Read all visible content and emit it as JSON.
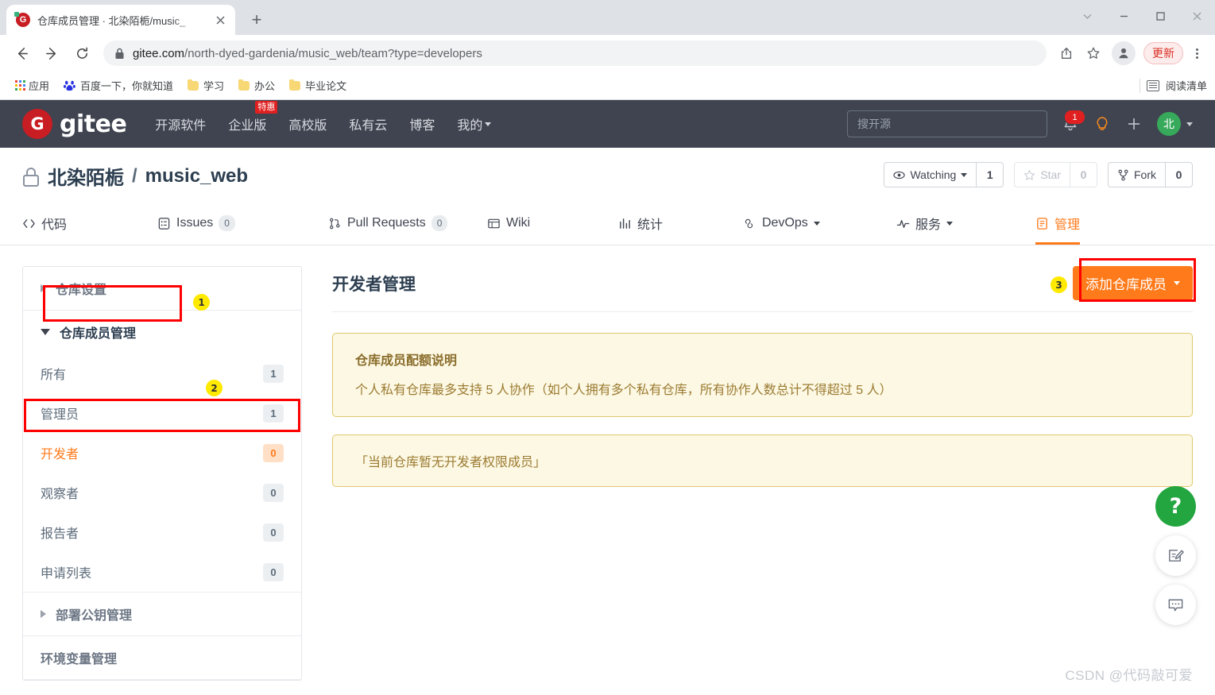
{
  "browser": {
    "tab": {
      "title": "仓库成员管理 · 北染陌栀/music_",
      "favicon": "gitee-favicon",
      "close_icon": "close-icon"
    },
    "new_tab_icon": "plus-icon",
    "window_controls": [
      "chevron-down-icon",
      "minimize-icon",
      "maximize-icon",
      "close-icon"
    ],
    "nav": {
      "back_icon": "back-arrow-icon",
      "forward_icon": "forward-arrow-icon",
      "reload_icon": "reload-icon"
    },
    "omnibox": {
      "lock_icon": "lock-icon",
      "url_host": "gitee.com",
      "url_path": "/north-dyed-gardenia/music_web/team?type=developers"
    },
    "toolbar_icons": [
      "share-icon",
      "bookmark-star-icon",
      "profile-icon"
    ],
    "update_label": "更新",
    "menu_icon": "three-dots-icon",
    "bookmarks": [
      {
        "label": "应用",
        "icon": "apps-grid-icon"
      },
      {
        "label": "百度一下，你就知道",
        "icon": "baidu-icon"
      },
      {
        "label": "学习",
        "icon": "folder-icon"
      },
      {
        "label": "办公",
        "icon": "folder-icon"
      },
      {
        "label": "毕业论文",
        "icon": "folder-icon"
      }
    ],
    "reading_list": {
      "label": "阅读清单",
      "icon": "reading-list-icon"
    }
  },
  "gitee_header": {
    "logo_letter": "G",
    "logo_text": "gitee",
    "nav": [
      {
        "label": "开源软件",
        "badge": null,
        "caret": false
      },
      {
        "label": "企业版",
        "badge": "特惠",
        "caret": false
      },
      {
        "label": "高校版",
        "badge": null,
        "caret": false
      },
      {
        "label": "私有云",
        "badge": null,
        "caret": false
      },
      {
        "label": "博客",
        "badge": null,
        "caret": false
      },
      {
        "label": "我的",
        "badge": null,
        "caret": true
      }
    ],
    "search_placeholder": "搜开源",
    "notification_count": "1",
    "icons": [
      "bell-icon",
      "lightbulb-icon",
      "plus-icon"
    ],
    "avatar_letter": "北"
  },
  "repo": {
    "lock_icon": "lock-icon",
    "owner": "北染陌栀",
    "separator": "/",
    "name": "music_web",
    "actions": [
      {
        "name": "watching",
        "icon": "eye-icon",
        "label": "Watching",
        "caret": true,
        "count": "1",
        "disabled": false
      },
      {
        "name": "star",
        "icon": "star-icon",
        "label": "Star",
        "caret": false,
        "count": "0",
        "disabled": true
      },
      {
        "name": "fork",
        "icon": "fork-icon",
        "label": "Fork",
        "caret": false,
        "count": "0",
        "disabled": false
      }
    ],
    "tabs": [
      {
        "name": "code",
        "icon": "code-icon",
        "label": "代码",
        "badge": null,
        "caret": false,
        "active": false
      },
      {
        "name": "issues",
        "icon": "issues-icon",
        "label": "Issues",
        "badge": "0",
        "caret": false,
        "active": false
      },
      {
        "name": "pull-requests",
        "icon": "pull-request-icon",
        "label": "Pull Requests",
        "badge": "0",
        "caret": false,
        "active": false
      },
      {
        "name": "wiki",
        "icon": "wiki-icon",
        "label": "Wiki",
        "badge": null,
        "caret": false,
        "active": false
      },
      {
        "name": "stats",
        "icon": "chart-icon",
        "label": "统计",
        "badge": null,
        "caret": false,
        "active": false
      },
      {
        "name": "devops",
        "icon": "infinity-icon",
        "label": "DevOps",
        "badge": null,
        "caret": true,
        "active": false
      },
      {
        "name": "services",
        "icon": "activity-icon",
        "label": "服务",
        "badge": null,
        "caret": true,
        "active": false
      },
      {
        "name": "manage",
        "icon": "manage-icon",
        "label": "管理",
        "badge": null,
        "caret": false,
        "active": true
      }
    ]
  },
  "sidebar": {
    "sections": [
      {
        "type": "header",
        "name": "repo-settings",
        "label": "仓库设置",
        "expanded": false,
        "dark": false
      },
      {
        "type": "header",
        "name": "repo-members",
        "label": "仓库成员管理",
        "expanded": true,
        "dark": true
      },
      {
        "type": "item",
        "name": "all",
        "label": "所有",
        "count": "1",
        "active": false
      },
      {
        "type": "item",
        "name": "admins",
        "label": "管理员",
        "count": "1",
        "active": false
      },
      {
        "type": "item",
        "name": "developers",
        "label": "开发者",
        "count": "0",
        "active": true
      },
      {
        "type": "item",
        "name": "observers",
        "label": "观察者",
        "count": "0",
        "active": false
      },
      {
        "type": "item",
        "name": "reporters",
        "label": "报告者",
        "count": "0",
        "active": false
      },
      {
        "type": "item",
        "name": "applications",
        "label": "申请列表",
        "count": "0",
        "active": false
      },
      {
        "type": "header",
        "name": "deploy-keys",
        "label": "部署公钥管理",
        "expanded": false,
        "dark": false
      },
      {
        "type": "link",
        "name": "env-vars",
        "label": "环境变量管理"
      }
    ]
  },
  "main": {
    "title": "开发者管理",
    "add_button_label": "添加仓库成员",
    "notice": {
      "title": "仓库成员配额说明",
      "text": "个人私有仓库最多支持 5 人协作（如个人拥有多个私有仓库，所有协作人数总计不得超过 5 人）"
    },
    "empty_message": "「当前仓库暂无开发者权限成员」"
  },
  "annotations": [
    {
      "num": "1",
      "target": "repo-members-header"
    },
    {
      "num": "2",
      "target": "developers-item"
    },
    {
      "num": "3",
      "target": "add-member-button"
    }
  ],
  "fabs": [
    {
      "name": "help",
      "icon": "question-mark-icon",
      "label": "?"
    },
    {
      "name": "feedback",
      "icon": "edit-note-icon",
      "label": ""
    },
    {
      "name": "chat",
      "icon": "chat-bubble-icon",
      "label": ""
    }
  ],
  "watermark": "CSDN @代码敲可爱",
  "colors": {
    "gitee_red": "#c71d23",
    "accent_orange": "#ff7a1a",
    "header_bg": "#3f4450",
    "notice_bg": "#fcf8e3",
    "annotation_red": "#ff0000",
    "annotation_yellow": "#ffea00"
  }
}
